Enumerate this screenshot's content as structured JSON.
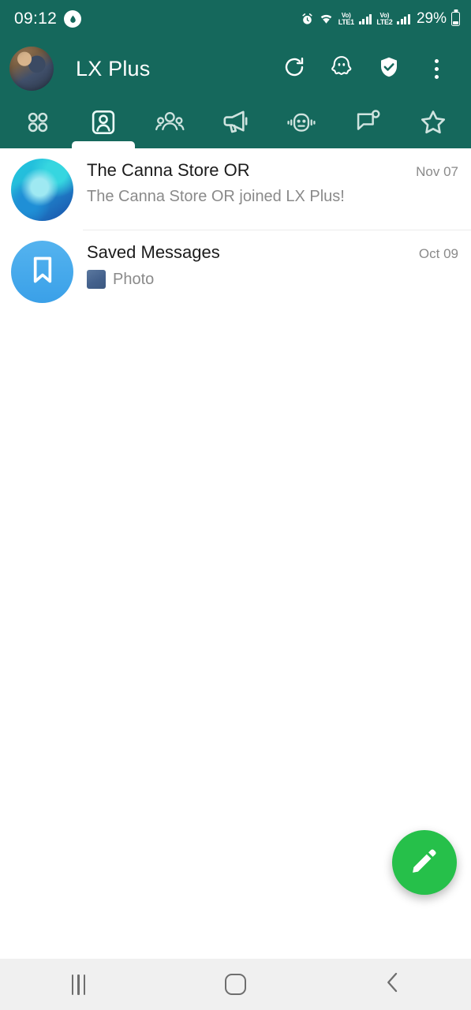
{
  "status_bar": {
    "time": "09:12",
    "battery_percent": "29%",
    "alarm_icon": "alarm-clock-icon",
    "droplet_icon": "droplet-icon",
    "wifi_icon": "wifi-icon",
    "sim1": {
      "volte_label": "Vo)",
      "network_label": "LTE1"
    },
    "sim2": {
      "volte_label": "Vo)",
      "network_label": "LTE2"
    }
  },
  "header": {
    "title": "LX Plus",
    "avatar_name": "user-avatar",
    "actions": [
      {
        "name": "refresh-button",
        "icon": "refresh-icon"
      },
      {
        "name": "ghost-mode-button",
        "icon": "ghost-icon"
      },
      {
        "name": "security-button",
        "icon": "shield-check-icon"
      },
      {
        "name": "overflow-menu-button",
        "icon": "three-dots-icon"
      }
    ]
  },
  "tabs": [
    {
      "name": "tab-apps",
      "icon": "grid-apps-icon",
      "active": false
    },
    {
      "name": "tab-contacts",
      "icon": "contact-card-icon",
      "active": true
    },
    {
      "name": "tab-groups",
      "icon": "people-group-icon",
      "active": false
    },
    {
      "name": "tab-channels",
      "icon": "megaphone-icon",
      "active": false
    },
    {
      "name": "tab-bots",
      "icon": "robot-icon",
      "active": false
    },
    {
      "name": "tab-chats",
      "icon": "chat-bubble-badge-icon",
      "active": false
    },
    {
      "name": "tab-favorites",
      "icon": "star-icon",
      "active": false
    }
  ],
  "chats": [
    {
      "title": "The Canna Store OR",
      "preview": "The Canna Store OR joined LX Plus!",
      "date": "Nov 07",
      "avatar_type": "photo",
      "has_thumb": false,
      "thumb_label": ""
    },
    {
      "title": "Saved Messages",
      "preview": "Photo",
      "date": "Oct 09",
      "avatar_type": "bookmark",
      "has_thumb": true,
      "thumb_label": "photo-thumbnail"
    }
  ],
  "fab": {
    "name": "compose-button",
    "icon": "pencil-icon",
    "color": "#26C04A"
  },
  "nav_bar": {
    "recents_label": "recents-button",
    "home_label": "home-button",
    "back_label": "back-button"
  },
  "colors": {
    "brand_teal": "#15685C",
    "fab_green": "#26C04A",
    "saved_blue": "#3AA0E8",
    "nav_bg": "#F0F0F0"
  }
}
